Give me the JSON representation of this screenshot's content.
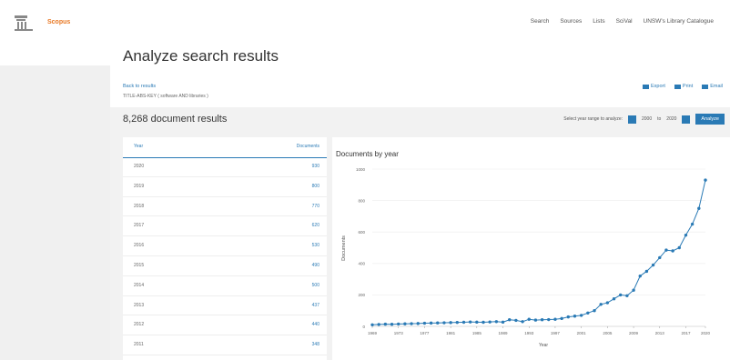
{
  "header": {
    "brand": "Scopus",
    "nav": [
      "Search",
      "Sources",
      "Lists",
      "SciVal",
      "UNSW's Library Catalogue"
    ]
  },
  "main": {
    "title": "Analyze search results",
    "back_link": "Back to results",
    "query": "TITLE-ABS-KEY ( software AND libraries )",
    "actions": [
      "Export",
      "Print",
      "Email"
    ],
    "result_count": "8,268 document results",
    "range_label": "Select year range to analyze:",
    "range_from": "2000",
    "range_to_label": "to",
    "range_to": "2020",
    "analyze_button": "Analyze"
  },
  "table": {
    "header_year": "Year",
    "header_docs": "Documents",
    "rows": [
      {
        "year": "2020",
        "docs": "930"
      },
      {
        "year": "2019",
        "docs": "800"
      },
      {
        "year": "2018",
        "docs": "770"
      },
      {
        "year": "2017",
        "docs": "620"
      },
      {
        "year": "2016",
        "docs": "530"
      },
      {
        "year": "2015",
        "docs": "490"
      },
      {
        "year": "2014",
        "docs": "500"
      },
      {
        "year": "2013",
        "docs": "437"
      },
      {
        "year": "2012",
        "docs": "440"
      },
      {
        "year": "2011",
        "docs": "348"
      }
    ]
  },
  "colors": {
    "accent": "#2a7ab5",
    "brand": "#e87722"
  },
  "chart_data": {
    "type": "line",
    "title": "Documents by year",
    "xlabel": "Year",
    "ylabel": "Documents",
    "x_ticks": [
      "1969",
      "1973",
      "1977",
      "1981",
      "1985",
      "1989",
      "1993",
      "1997",
      "2001",
      "2005",
      "2009",
      "2013",
      "2017",
      "2020"
    ],
    "y_ticks": [
      0,
      200,
      400,
      600,
      800,
      1000
    ],
    "ylim": [
      0,
      1000
    ],
    "xlim": [
      1969,
      2020
    ],
    "series": [
      {
        "x": [
          1969,
          1970,
          1971,
          1972,
          1973,
          1974,
          1975,
          1976,
          1977,
          1978,
          1979,
          1980,
          1981,
          1982,
          1983,
          1984,
          1985,
          1986,
          1987,
          1988,
          1989,
          1990,
          1991,
          1992,
          1993,
          1994,
          1995,
          1996,
          1997,
          1998,
          1999,
          2000,
          2001,
          2002,
          2003,
          2004,
          2005,
          2006,
          2007,
          2008,
          2009,
          2010,
          2011,
          2012,
          2013,
          2014,
          2015,
          2016,
          2017,
          2018,
          2019,
          2020
        ],
        "y": [
          10,
          12,
          14,
          13,
          15,
          16,
          17,
          18,
          20,
          21,
          22,
          23,
          24,
          25,
          26,
          28,
          27,
          26,
          28,
          30,
          27,
          42,
          38,
          30,
          45,
          40,
          42,
          43,
          45,
          50,
          60,
          65,
          70,
          85,
          100,
          140,
          150,
          175,
          200,
          195,
          230,
          320,
          350,
          390,
          437,
          485,
          480,
          500,
          580,
          650,
          750,
          930
        ]
      }
    ]
  }
}
